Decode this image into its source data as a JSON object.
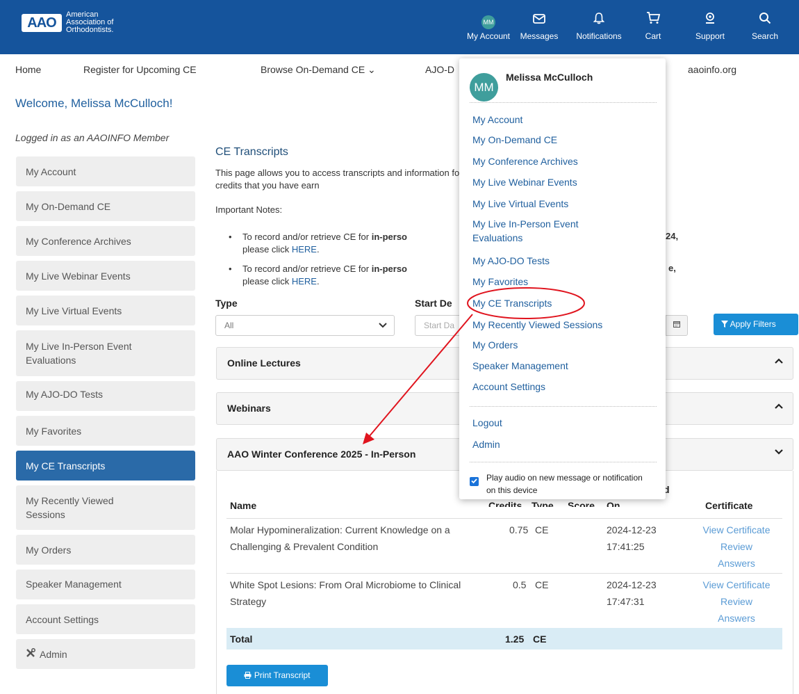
{
  "header": {
    "logo_mark": "AAO",
    "logo_lines": [
      "American",
      "Association of",
      "Orthodontists."
    ],
    "avatar_initials": "MM",
    "icons": [
      {
        "icon": "user-avatar-icon",
        "label": "My Account"
      },
      {
        "icon": "envelope-icon",
        "label": "Messages"
      },
      {
        "icon": "bell-icon",
        "label": "Notifications"
      },
      {
        "icon": "cart-icon",
        "label": "Cart"
      },
      {
        "icon": "support-icon",
        "label": "Support"
      },
      {
        "icon": "search-icon",
        "label": "Search"
      }
    ],
    "brand_color": "#15549c"
  },
  "subnav": {
    "home": "Home",
    "register": "Register for Upcoming CE",
    "browse": "Browse On-Demand CE ⌄",
    "ajo": "AJO-D",
    "aaoinfo": "aaoinfo.org"
  },
  "welcome": "Welcome, Melissa McCulloch!",
  "logged_in": "Logged in as an AAOINFO Member",
  "sidebar": {
    "items": [
      {
        "label": "My Account"
      },
      {
        "label": "My On-Demand CE"
      },
      {
        "label": "My Conference Archives"
      },
      {
        "label": "My Live Webinar Events"
      },
      {
        "label": "My Live Virtual Events"
      },
      {
        "label": "My Live In-Person Event Evaluations"
      },
      {
        "label": "My AJO-DO Tests"
      },
      {
        "label": "My Favorites"
      },
      {
        "label": "My CE Transcripts",
        "active": true
      },
      {
        "label": "My Recently Viewed Sessions"
      },
      {
        "label": "My Orders"
      },
      {
        "label": "Speaker Management"
      },
      {
        "label": "Account Settings"
      },
      {
        "label": "Admin",
        "icon": "tools-icon"
      }
    ]
  },
  "main": {
    "title": "CE Transcripts",
    "intro": "This page allows you to access transcripts and information for CE credits that you have earn",
    "notes_title": "Important Notes:",
    "note1_pre": "To record and/or retrieve CE for ",
    "note1_bold": "in-perso",
    "note1_link_pre": "please click ",
    "note1_link": "HERE",
    "note1_tail": "24,",
    "note2_pre": "To record and/or retrieve CE for ",
    "note2_bold": "in-perso",
    "note2_link_pre": "please click ",
    "note2_link": "HERE",
    "note2_tail": "e,",
    "filters": {
      "type_label": "Type",
      "type_value": "All",
      "start_label": "Start De",
      "start_placeholder": "Start Da",
      "apply_label": "Apply Filters"
    },
    "panels": [
      {
        "title": "Online Lectures",
        "caret": "^"
      },
      {
        "title": "Webinars",
        "caret": "^"
      },
      {
        "title": "AAO Winter Conference 2025 - In-Person",
        "caret": "⌄"
      }
    ],
    "table": {
      "header_name": "Name",
      "header_credits": "Credits",
      "header_type": "Type",
      "header_score": "Score",
      "header_on_top": "d",
      "header_on": "On",
      "header_certificate": "Certificate",
      "rows": [
        {
          "name": "Molar Hypomineralization: Current Knowledge on a Challenging & Prevalent Condition",
          "credits": "0.75",
          "type": "CE",
          "date": "2024-12-23",
          "time": "17:41:25",
          "cert_link": "View Certificate",
          "review_link": "Review",
          "answers": "Answers"
        },
        {
          "name": "White Spot Lesions: From Oral Microbiome to Clinical Strategy",
          "credits": "0.5",
          "type": "CE",
          "date": "2024-12-23",
          "time": "17:47:31",
          "cert_link": "View Certificate",
          "review_link": "Review",
          "answers": "Answers"
        }
      ],
      "total_label": "Total",
      "total_credits": "1.25",
      "total_type": "CE"
    },
    "print_label": "Print Transcript"
  },
  "dropdown": {
    "initials": "MM",
    "name": "Melissa McCulloch",
    "items": [
      "My Account",
      "My On-Demand CE",
      "My Conference Archives",
      "My Live Webinar Events",
      "My Live Virtual Events",
      "My Live In-Person Event Evaluations",
      "My AJO-DO Tests",
      "My Favorites",
      "My CE Transcripts",
      "My Recently Viewed Sessions",
      "My Orders",
      "Speaker Management",
      "Account Settings"
    ],
    "logout": "Logout",
    "admin": "Admin",
    "audio_setting": "Play audio on new message or notification on this device",
    "audio_checked": true
  },
  "annotation_color": "#e0141e"
}
